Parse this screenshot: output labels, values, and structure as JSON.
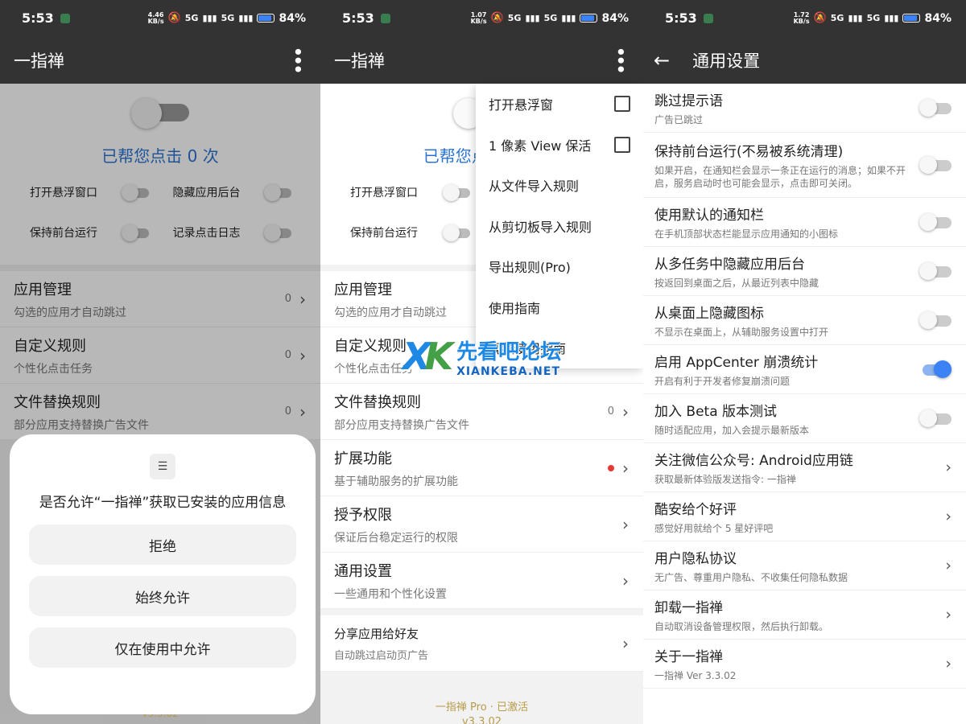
{
  "status": [
    {
      "time": "5:53",
      "speed_top": "4.46",
      "speed_unit": "KB/s",
      "net1": "5G",
      "net2": "5G",
      "battery": "84%"
    },
    {
      "time": "5:53",
      "speed_top": "1.07",
      "speed_unit": "KB/s",
      "net1": "5G",
      "net2": "5G",
      "battery": "84%"
    },
    {
      "time": "5:53",
      "speed_top": "1.72",
      "speed_unit": "KB/s",
      "net1": "5G",
      "net2": "5G",
      "battery": "84%"
    }
  ],
  "app": {
    "title": "一指禅",
    "settings_title": "通用设置"
  },
  "home": {
    "clicks_label": "已帮您点击 0 次",
    "switches": [
      "打开悬浮窗口",
      "隐藏应用后台",
      "保持前台运行",
      "记录点击日志"
    ],
    "items": [
      {
        "title": "应用管理",
        "sub": "勾选的应用才自动跳过",
        "count": "0"
      },
      {
        "title": "自定义规则",
        "sub": "个性化点击任务",
        "count": "0"
      },
      {
        "title": "文件替换规则",
        "sub": "部分应用支持替换广告文件",
        "count": "0"
      },
      {
        "title": "扩展功能",
        "sub": "基于辅助服务的扩展功能"
      },
      {
        "title": "授予权限",
        "sub": "保证后台稳定运行的权限"
      },
      {
        "title": "通用设置",
        "sub": "一些通用和个性化设置"
      }
    ],
    "share": {
      "title": "分享应用给好友",
      "sub": "自动跳过启动页广告"
    },
    "footer_line1": "一指禅 Pro · 已激活",
    "footer_line2": "v3.3.02",
    "version_short": "v3.3.02"
  },
  "dialog": {
    "title": "是否允许“一指禅”获取已安装的应用信息",
    "deny": "拒绝",
    "always": "始终允许",
    "while_using": "仅在使用中允许"
  },
  "menu": [
    {
      "label": "打开悬浮窗",
      "checkbox": true
    },
    {
      "label": "1 像素 View 保活",
      "checkbox": true
    },
    {
      "label": "从文件导入规则"
    },
    {
      "label": "从剪切板导入规则"
    },
    {
      "label": "导出规则(Pro)"
    },
    {
      "label": "使用指南"
    },
    {
      "label": "视频使用指南"
    }
  ],
  "settings": [
    {
      "title": "跳过提示语",
      "sub": "广告已跳过",
      "type": "switch",
      "on": false
    },
    {
      "title": "保持前台运行(不易被系统清理)",
      "sub": "如果开启，在通知栏会显示一条正在运行的消息；如果不开启，服务启动时也可能会显示，点击即可关闭。",
      "type": "switch",
      "on": false
    },
    {
      "title": "使用默认的通知栏",
      "sub": "在手机顶部状态栏能显示应用通知的小图标",
      "type": "switch",
      "on": false
    },
    {
      "title": "从多任务中隐藏应用后台",
      "sub": "按返回到桌面之后，从最近列表中隐藏",
      "type": "switch",
      "on": false
    },
    {
      "title": "从桌面上隐藏图标",
      "sub": "不显示在桌面上，从辅助服务设置中打开",
      "type": "switch",
      "on": false
    },
    {
      "title": "启用 AppCenter 崩溃统计",
      "sub": "开启有利于开发者修复崩溃问题",
      "type": "switch",
      "on": true
    },
    {
      "title": "加入 Beta 版本测试",
      "sub": "随时适配应用，加入会提示最新版本",
      "type": "switch",
      "on": false
    },
    {
      "title": "关注微信公众号: Android应用链",
      "sub": "获取最新体验版发送指令: 一指禅",
      "type": "chevron"
    },
    {
      "title": "酷安给个好评",
      "sub": "感觉好用就给个 5 星好评吧",
      "type": "chevron"
    },
    {
      "title": "用户隐私协议",
      "sub": "无广告、尊重用户隐私、不收集任何隐私数据",
      "type": "chevron"
    },
    {
      "title": "卸载一指禅",
      "sub": "自动取消设备管理权限，然后执行卸载。",
      "type": "chevron"
    },
    {
      "title": "关于一指禅",
      "sub": "一指禅 Ver 3.3.02",
      "type": "chevron"
    }
  ],
  "watermark": {
    "cn": "先看吧论坛",
    "en": "XIANKEBA.NET"
  },
  "colors": {
    "accent": "#2a73d4",
    "switch_on": "#3b82f6",
    "appbar": "#333333",
    "footer": "#b89b4a"
  }
}
